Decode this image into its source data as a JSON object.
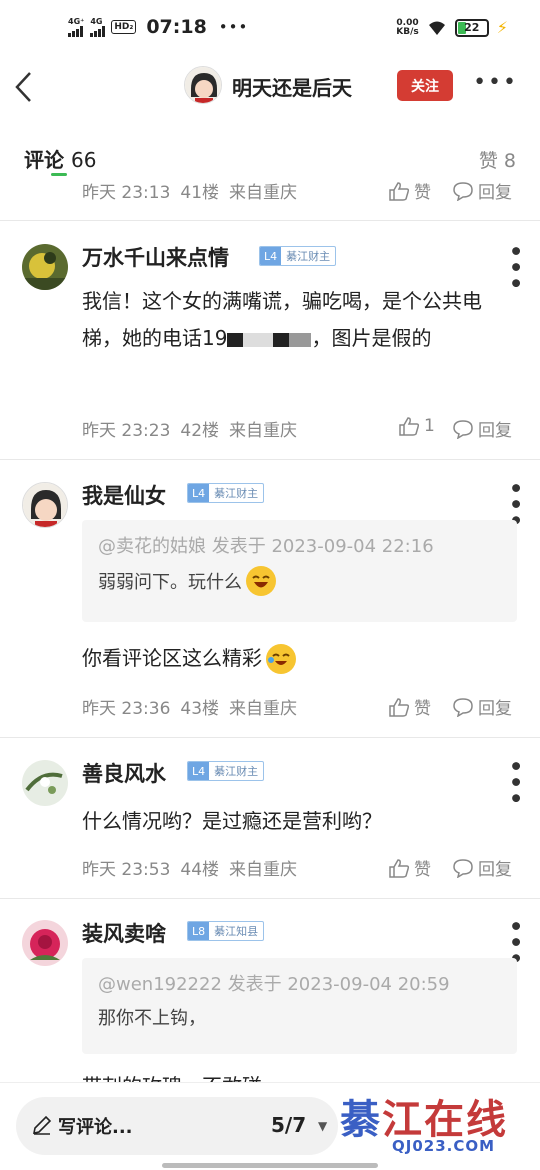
{
  "status_bar": {
    "sim1": "4G⁺",
    "sim2": "4G",
    "hd": "HD₂",
    "time": "07:18",
    "net_speed": "0.00",
    "net_unit": "KB/s",
    "battery": "22"
  },
  "header": {
    "title": "明天还是后天",
    "follow_label": "关注"
  },
  "tabs": {
    "comments_label": "评论",
    "comments_count": "66",
    "likes_label": "赞",
    "likes_count": "8"
  },
  "comments": [
    {
      "time": "昨天 23:13",
      "floor": "41楼",
      "location": "来自重庆",
      "like_label": "赞",
      "reply_label": "回复"
    },
    {
      "name": "万水千山来点情",
      "level": "L4",
      "rank": "綦江财主",
      "text_a": "我信！这个女的满嘴谎，骗吃喝，是个公共电梯，她的电话19",
      "text_b": "，图片是假的",
      "time": "昨天 23:23",
      "floor": "42楼",
      "location": "来自重庆",
      "like_count": "1",
      "reply_label": "回复"
    },
    {
      "name": "我是仙女",
      "level": "L4",
      "rank": "綦江财主",
      "quote_head": "@卖花的姑娘 发表于 2023-09-04 22:16",
      "quote_body": "弱弱问下。玩什么",
      "text": "你看评论区这么精彩",
      "time": "昨天 23:36",
      "floor": "43楼",
      "location": "来自重庆",
      "like_label": "赞",
      "reply_label": "回复"
    },
    {
      "name": "善良风水",
      "level": "L4",
      "rank": "綦江财主",
      "text": "什么情况哟？是过瘾还是营利哟？",
      "time": "昨天 23:53",
      "floor": "44楼",
      "location": "来自重庆",
      "like_label": "赞",
      "reply_label": "回复"
    },
    {
      "name": "装风卖啥",
      "level": "L8",
      "rank": "綦江知县",
      "quote_head": "@wen192222 发表于 2023-09-04 20:59",
      "quote_body": "那你不上钩，",
      "text_partial": "带刺的玫瑰，不敢碰"
    }
  ],
  "bottom": {
    "write_label": "写评论...",
    "page": "5/7"
  },
  "watermark": {
    "text_a": "綦",
    "text_b": "江在线",
    "url": "QJ023.COM"
  },
  "colors": {
    "accent_green": "#3cba54",
    "follow_red": "#d43c33",
    "badge_blue": "#6fa6e3"
  }
}
